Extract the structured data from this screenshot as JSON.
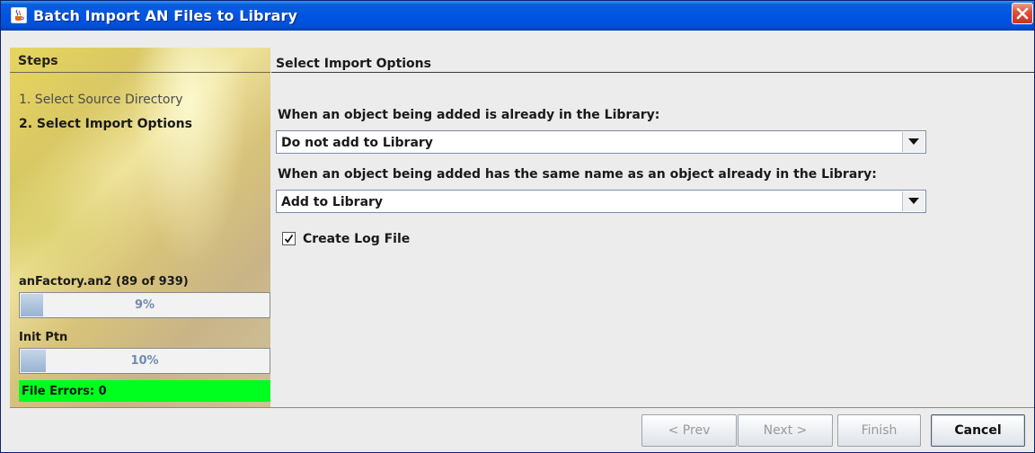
{
  "window": {
    "title": "Batch Import AN Files to Library",
    "icon": "java-cup-icon",
    "close_icon": "close-icon"
  },
  "steps_panel": {
    "header": "Steps",
    "items": [
      {
        "label": "1. Select Source Directory",
        "active": false
      },
      {
        "label": "2. Select Import Options",
        "active": true
      }
    ],
    "progress": [
      {
        "label": "anFactory.an2 (89 of 939)",
        "percent_text": "9%",
        "value": 0.09
      },
      {
        "label": "Init Ptn",
        "percent_text": "10%",
        "value": 0.1
      }
    ],
    "errors": "File Errors: 0",
    "errors_color": "#00ff1e"
  },
  "content": {
    "title": "Select Import Options",
    "duplicate_object": {
      "label": "When an object being added is already in the Library:",
      "selected": "Do not add to Library"
    },
    "same_name": {
      "label": "When an object being added has the same name as an object already in the Library:",
      "selected": "Add to Library"
    },
    "create_log": {
      "label": "Create Log File",
      "checked": true
    }
  },
  "buttons": {
    "prev": "< Prev",
    "next": "Next >",
    "finish": "Finish",
    "cancel": "Cancel"
  }
}
